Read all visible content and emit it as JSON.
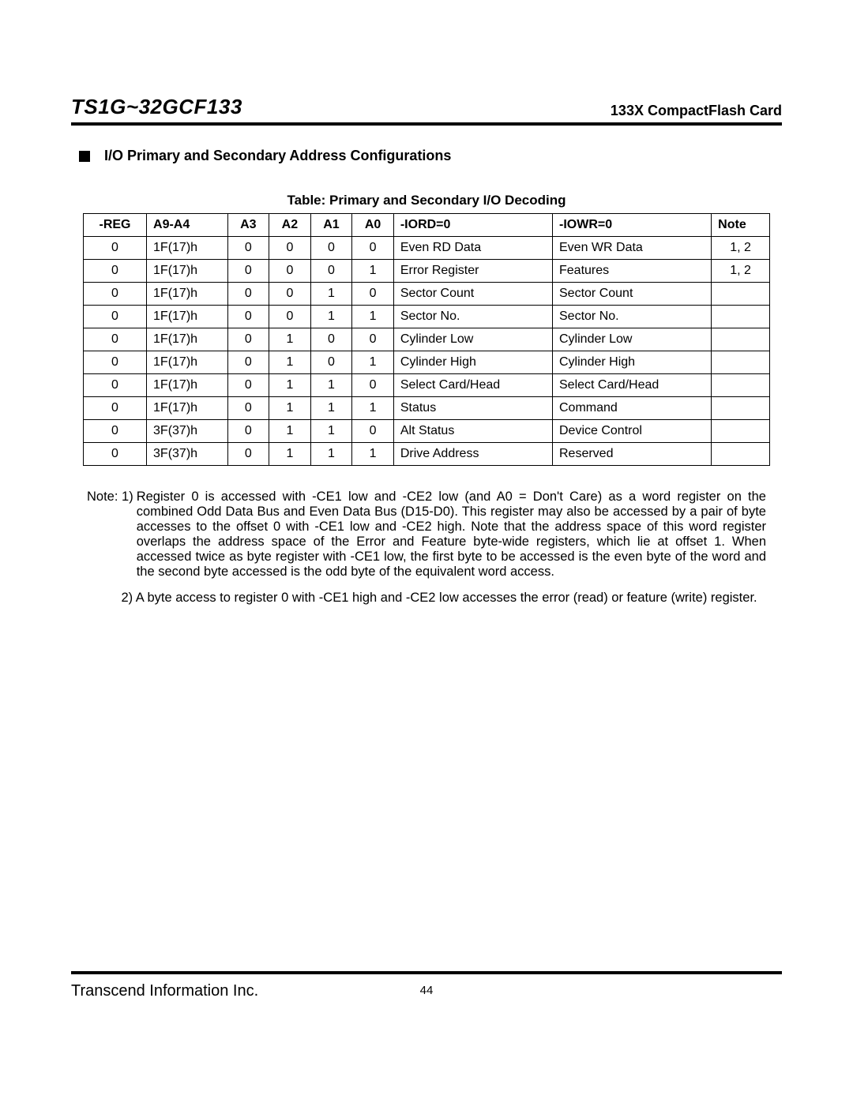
{
  "header": {
    "model": "TS1G~32GCF133",
    "product": "133X CompactFlash Card"
  },
  "section_title": "I/O Primary and Secondary Address Configurations",
  "table": {
    "caption": "Table: Primary and Secondary I/O Decoding",
    "headers": [
      "-REG",
      "A9-A4",
      "A3",
      "A2",
      "A1",
      "A0",
      "-IORD=0",
      "-IOWR=0",
      "Note"
    ],
    "rows": [
      [
        "0",
        "1F(17)h",
        "0",
        "0",
        "0",
        "0",
        "Even RD Data",
        "Even WR Data",
        "1, 2"
      ],
      [
        "0",
        "1F(17)h",
        "0",
        "0",
        "0",
        "1",
        "Error Register",
        "Features",
        "1, 2"
      ],
      [
        "0",
        "1F(17)h",
        "0",
        "0",
        "1",
        "0",
        "Sector Count",
        "Sector Count",
        ""
      ],
      [
        "0",
        "1F(17)h",
        "0",
        "0",
        "1",
        "1",
        "Sector No.",
        "Sector No.",
        ""
      ],
      [
        "0",
        "1F(17)h",
        "0",
        "1",
        "0",
        "0",
        "Cylinder Low",
        "Cylinder Low",
        ""
      ],
      [
        "0",
        "1F(17)h",
        "0",
        "1",
        "0",
        "1",
        "Cylinder High",
        "Cylinder High",
        ""
      ],
      [
        "0",
        "1F(17)h",
        "0",
        "1",
        "1",
        "0",
        "Select Card/Head",
        "Select Card/Head",
        ""
      ],
      [
        "0",
        "1F(17)h",
        "0",
        "1",
        "1",
        "1",
        "Status",
        "Command",
        ""
      ],
      [
        "0",
        "3F(37)h",
        "0",
        "1",
        "1",
        "0",
        "Alt Status",
        "Device Control",
        ""
      ],
      [
        "0",
        "3F(37)h",
        "0",
        "1",
        "1",
        "1",
        "Drive Address",
        "Reserved",
        ""
      ]
    ]
  },
  "notes": {
    "label": "Note:",
    "note1_prefix": "1)",
    "note1": "Register 0 is accessed with -CE1 low and -CE2 low (and A0 = Don't Care) as a word register on the combined Odd Data Bus and Even Data Bus (D15-D0). This register may also be accessed by a pair of byte accesses to the offset 0 with -CE1 low and -CE2 high. Note that the address space of this word register overlaps the address space of the Error and Feature byte-wide registers, which lie at offset 1. When accessed twice as byte register with -CE1 low, the first byte to be accessed is the even byte of the word and the second byte accessed is the odd byte of the equivalent word access.",
    "note2": "2) A byte access to register 0 with -CE1 high and -CE2 low accesses the error (read) or feature (write) register."
  },
  "footer": {
    "company": "Transcend Information Inc.",
    "page_number": "44"
  }
}
